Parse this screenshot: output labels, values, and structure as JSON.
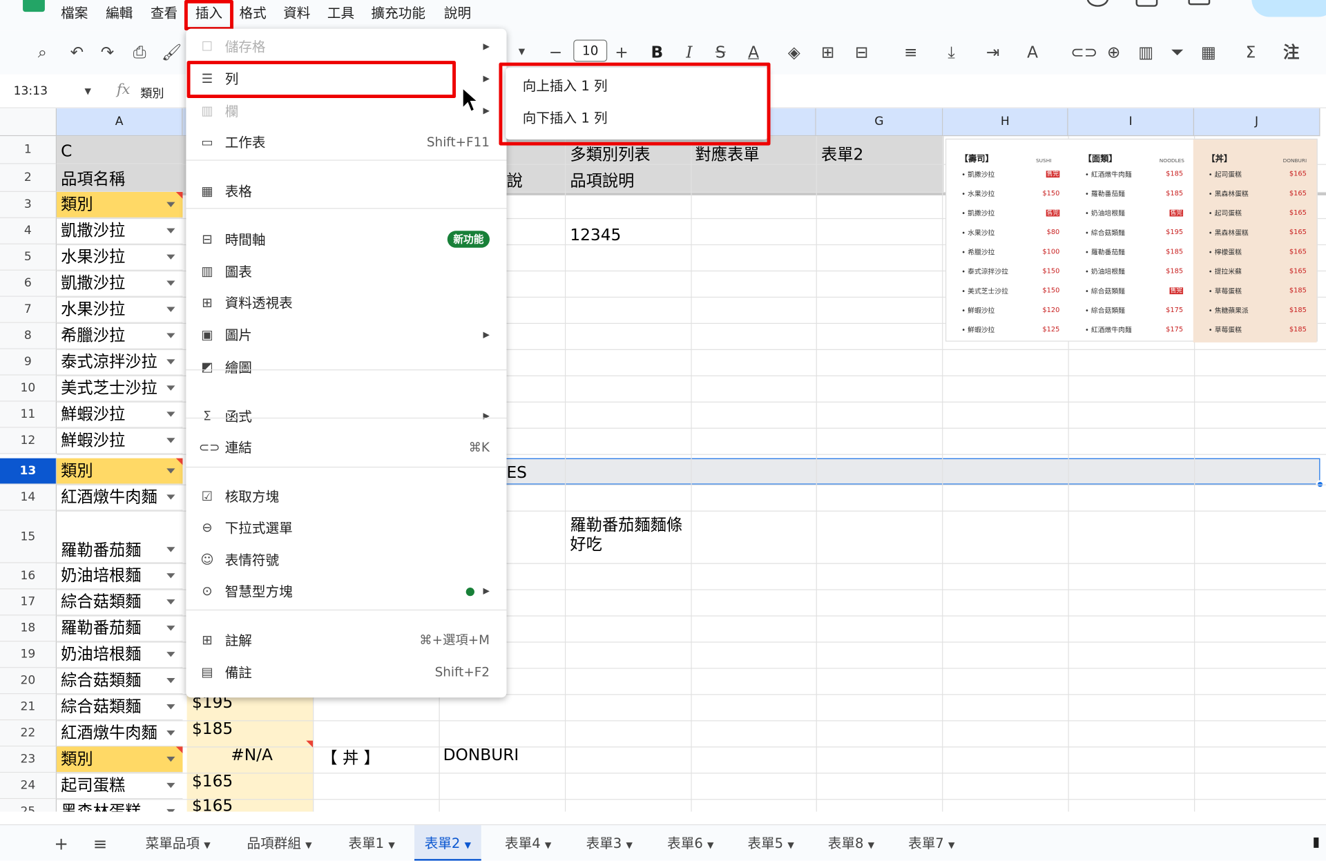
{
  "menubar": [
    "檔案",
    "編輯",
    "查看",
    "插入",
    "格式",
    "資料",
    "工具",
    "擴充功能",
    "說明"
  ],
  "toolbar": {
    "font_size": "10",
    "bold": "B",
    "italic": "I",
    "comment_short": "注"
  },
  "formula_bar": {
    "cell_ref": "13:13",
    "fx": "fx",
    "value": "類別"
  },
  "columns": [
    "A",
    "G",
    "H",
    "I",
    "J"
  ],
  "rows": [
    "1",
    "2",
    "3",
    "4",
    "5",
    "6",
    "7",
    "8",
    "9",
    "10",
    "11",
    "12",
    "13",
    "14",
    "15",
    "16",
    "17",
    "18",
    "19",
    "20",
    "21",
    "22",
    "23",
    "24",
    "25"
  ],
  "colA": [
    "C",
    "品項名稱",
    "類別",
    "凱撒沙拉",
    "水果沙拉",
    "凱撒沙拉",
    "水果沙拉",
    "希臘沙拉",
    "泰式涼拌沙拉",
    "美式芝士沙拉",
    "鮮蝦沙拉",
    "鮮蝦沙拉",
    "類別",
    "紅酒燉牛肉麵",
    "羅勒番茄麵",
    "奶油培根麵",
    "綜合菇類麵",
    "羅勒番茄麵",
    "奶油培根麵",
    "綜合菇類麵",
    "綜合菇類麵",
    "紅酒燉牛肉麵",
    "類別",
    "起司蛋糕",
    "黑森林蛋糕"
  ],
  "cells": {
    "f1": "多類別列表",
    "g1": "對應表單",
    "h1": "表單2",
    "f2_partial": "說",
    "f2": "品項說明",
    "f4": "12345",
    "e13_partial": "ES",
    "f15": "羅勒番茄麵麵條好吃",
    "b21": "$195",
    "b22": "$185",
    "b23": "#N/A",
    "c23": "【 丼 】",
    "d23": "DONBURI",
    "b24": "$165",
    "b25": "$165"
  },
  "insert_menu": {
    "items": [
      {
        "label": "儲存格",
        "disabled": true,
        "icon": "cell-icon"
      },
      {
        "label": "列",
        "icon": "row-icon"
      },
      {
        "label": "欄",
        "disabled": true,
        "icon": "column-icon"
      },
      {
        "label": "工作表",
        "shortcut": "Shift+F11",
        "icon": "sheet-icon"
      },
      {
        "label": "表格",
        "icon": "table-icon"
      },
      {
        "label": "時間軸",
        "badge": "新功能",
        "icon": "timeline-icon"
      },
      {
        "label": "圖表",
        "icon": "chart-icon"
      },
      {
        "label": "資料透視表",
        "icon": "pivot-icon"
      },
      {
        "label": "圖片",
        "icon": "image-icon"
      },
      {
        "label": "繪圖",
        "icon": "drawing-icon"
      },
      {
        "label": "函式",
        "icon": "function-icon"
      },
      {
        "label": "連結",
        "shortcut": "⌘K",
        "icon": "link-icon"
      },
      {
        "label": "核取方塊",
        "icon": "checkbox-icon"
      },
      {
        "label": "下拉式選單",
        "icon": "dropdown-icon"
      },
      {
        "label": "表情符號",
        "icon": "emoji-icon"
      },
      {
        "label": "智慧型方塊",
        "icon": "smart-chip-icon"
      },
      {
        "label": "註解",
        "shortcut": "⌘+選項+M",
        "icon": "comment-icon"
      },
      {
        "label": "備註",
        "shortcut": "Shift+F2",
        "icon": "note-icon"
      }
    ]
  },
  "submenu": {
    "above": "向上插入 1 列",
    "below": "向下插入 1 列"
  },
  "menu_image": {
    "sushi": {
      "title": "【壽司】",
      "tag": "SUSHI",
      "items": [
        "凱撒沙拉",
        "水果沙拉",
        "凱撒沙拉",
        "水果沙拉",
        "希臘沙拉",
        "泰式涼拌沙拉",
        "美式芝士沙拉",
        "鮮蝦沙拉",
        "鮮蝦沙拉"
      ],
      "prices": [
        "售完",
        "$150",
        "售完",
        "$80",
        "$100",
        "$150",
        "$150",
        "$120",
        "$125"
      ]
    },
    "noodles": {
      "title": "【面類】",
      "tag": "NOODLES",
      "items": [
        "紅酒燉牛肉麵",
        "羅勒番茄麵",
        "奶油培根麵",
        "綜合菇類麵",
        "羅勒番茄麵",
        "奶油培根麵",
        "綜合菇類麵",
        "綜合菇類麵",
        "紅酒燉牛肉麵"
      ],
      "prices": [
        "$185",
        "$185",
        "售完",
        "$195",
        "$185",
        "$185",
        "售完",
        "$175",
        "$175"
      ]
    },
    "donburi": {
      "title": "【丼】",
      "tag": "DONBURI",
      "items": [
        "起司蛋糕",
        "黑森林蛋糕",
        "起司蛋糕",
        "黑森林蛋糕",
        "檸檬蛋糕",
        "提拉米蘇",
        "草莓蛋糕",
        "焦糖蘋果派",
        "草莓蛋糕"
      ],
      "prices": [
        "$165",
        "$165",
        "$165",
        "$165",
        "$165",
        "$165",
        "$185",
        "$185",
        "$185"
      ]
    }
  },
  "tabs": [
    "菜單品項",
    "品項群組",
    "表單1",
    "表單2",
    "表單4",
    "表單3",
    "表單6",
    "表單5",
    "表單8",
    "表單7"
  ],
  "active_tab": "表單2",
  "colors": {
    "accent": "#0b57d0",
    "category_fill": "#ffd966",
    "highlight": "#e00000"
  }
}
